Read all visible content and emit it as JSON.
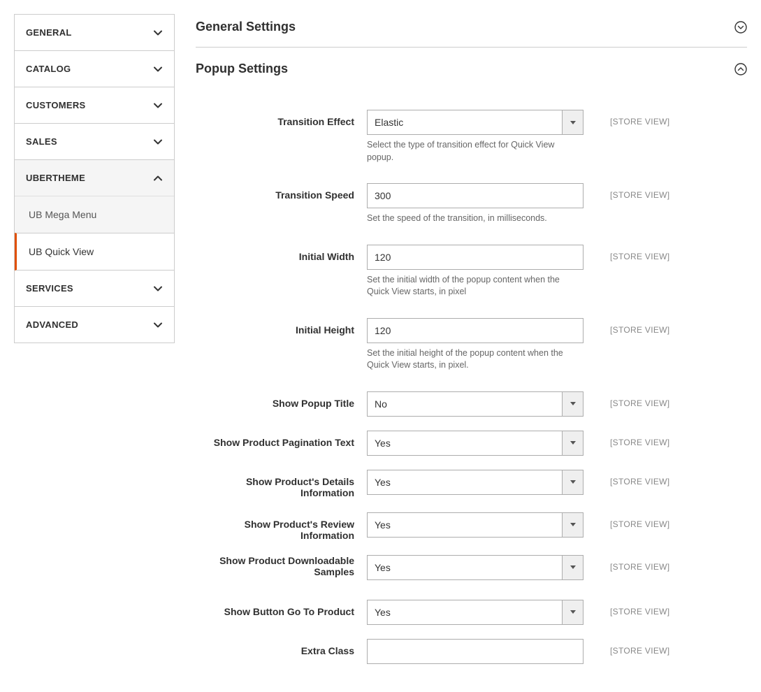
{
  "sidebar": {
    "sections": [
      {
        "key": "general",
        "label": "GENERAL",
        "expanded": false
      },
      {
        "key": "catalog",
        "label": "CATALOG",
        "expanded": false
      },
      {
        "key": "customers",
        "label": "CUSTOMERS",
        "expanded": false
      },
      {
        "key": "sales",
        "label": "SALES",
        "expanded": false
      },
      {
        "key": "ubertheme",
        "label": "UBERTHEME",
        "expanded": true,
        "items": [
          {
            "key": "ub-mega-menu",
            "label": "UB Mega Menu",
            "active": false
          },
          {
            "key": "ub-quick-view",
            "label": "UB Quick View",
            "active": true
          }
        ]
      },
      {
        "key": "services",
        "label": "SERVICES",
        "expanded": false
      },
      {
        "key": "advanced",
        "label": "ADVANCED",
        "expanded": false
      }
    ]
  },
  "sections": {
    "general": {
      "title": "General Settings",
      "expanded": false
    },
    "popup": {
      "title": "Popup Settings",
      "expanded": true
    }
  },
  "scope_label": "[STORE VIEW]",
  "fields": {
    "transition_effect": {
      "label": "Transition Effect",
      "value": "Elastic",
      "note": "Select the type of transition effect for Quick View popup."
    },
    "transition_speed": {
      "label": "Transition Speed",
      "value": "300",
      "note": "Set the speed of the transition, in milliseconds."
    },
    "initial_width": {
      "label": "Initial Width",
      "value": "120",
      "note": "Set the initial width of the popup content when the Quick View starts, in pixel"
    },
    "initial_height": {
      "label": "Initial Height",
      "value": "120",
      "note": "Set the initial height of the popup content when the Quick View starts, in pixel."
    },
    "show_popup_title": {
      "label": "Show Popup Title",
      "value": "No"
    },
    "show_product_pagination_text": {
      "label": "Show Product Pagination Text",
      "value": "Yes"
    },
    "show_product_details": {
      "label": "Show Product's Details Information",
      "value": "Yes"
    },
    "show_product_review": {
      "label": "Show Product's Review Information",
      "value": "Yes"
    },
    "show_product_downloadable": {
      "label": "Show Product Downloadable Samples",
      "value": "Yes"
    },
    "show_button_goto_product": {
      "label": "Show Button Go To Product",
      "value": "Yes"
    },
    "extra_class": {
      "label": "Extra Class",
      "value": ""
    }
  }
}
